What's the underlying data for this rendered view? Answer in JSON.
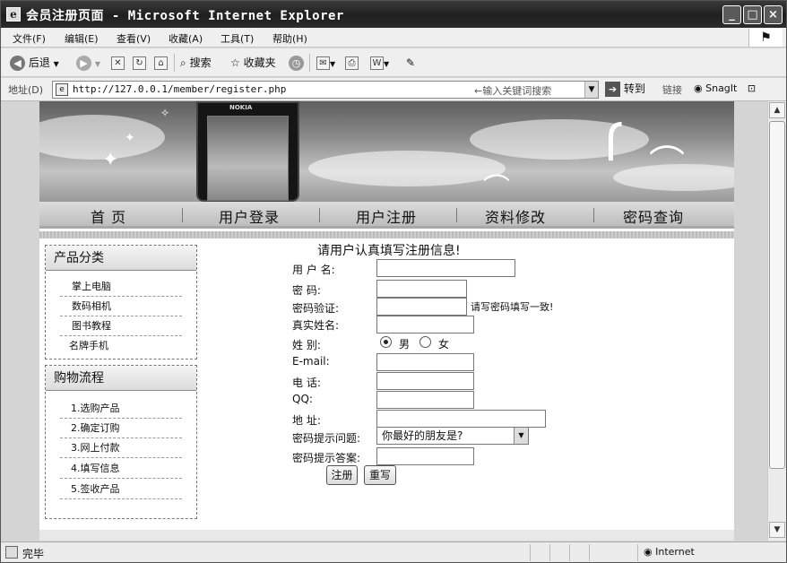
{
  "window": {
    "title": "会员注册页面 - Microsoft Internet Explorer",
    "minimize": "_",
    "maximize": "□",
    "close": "×"
  },
  "menu": [
    "文件(F)",
    "编辑(E)",
    "查看(V)",
    "收藏(A)",
    "工具(T)",
    "帮助(H)"
  ],
  "toolbar": {
    "back": "后退",
    "search": "搜索",
    "favorites": "收藏夹"
  },
  "address": {
    "label": "地址(D)",
    "url": "http://127.0.0.1/member/register.php",
    "hint": "←输入关键词搜索",
    "go": "转到",
    "links": "链接",
    "snagit": "SnagIt"
  },
  "banner": {
    "phone_brand": "NOKIA"
  },
  "nav": [
    "首  页",
    "用户登录",
    "用户注册",
    "资料修改",
    "密码查询"
  ],
  "sidebar": {
    "categories": {
      "title": "产品分类",
      "items": [
        "掌上电脑",
        "数码相机",
        "图书教程",
        "名牌手机"
      ]
    },
    "process": {
      "title": "购物流程",
      "items": [
        "1.选购产品",
        "2.确定订购",
        "3.网上付款",
        "4.填写信息",
        "5.签收产品"
      ]
    }
  },
  "form": {
    "title": "请用户认真填写注册信息!",
    "labels": {
      "username": "用 户 名:",
      "password": "密  码:",
      "confirm": "密码验证:",
      "realname": "真实姓名:",
      "gender": "姓  别:",
      "email": "E-mail:",
      "phone": "电  话:",
      "qq": "QQ:",
      "address": "地  址:",
      "question": "密码提示问题:",
      "answer": "密码提示答案:"
    },
    "confirm_note": "请写密码填写一致!",
    "gender_options": [
      "男",
      "女"
    ],
    "gender_selected": "男",
    "question_selected": "你最好的朋友是?",
    "submit": "注册",
    "reset": "重写"
  },
  "status": {
    "text": "完毕",
    "zone": "Internet"
  }
}
